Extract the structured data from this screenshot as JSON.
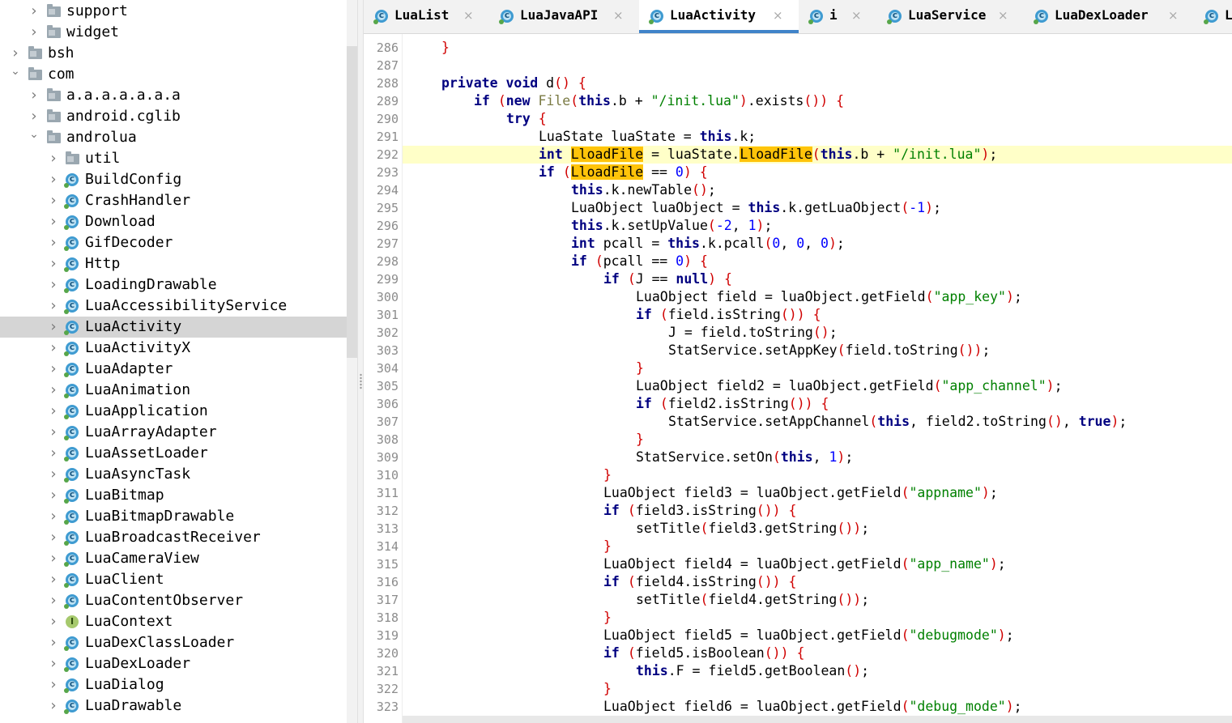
{
  "tree": {
    "items": [
      {
        "label": "support",
        "icon": "folder-icon",
        "depth": 2,
        "expanded": false
      },
      {
        "label": "widget",
        "icon": "folder-icon",
        "depth": 2,
        "expanded": false
      },
      {
        "label": "bsh",
        "icon": "folder-icon",
        "depth": 1,
        "expanded": false
      },
      {
        "label": "com",
        "icon": "folder-icon",
        "depth": 1,
        "expanded": true
      },
      {
        "label": "a.a.a.a.a.a.a",
        "icon": "folder-icon",
        "depth": 2,
        "expanded": false
      },
      {
        "label": "android.cglib",
        "icon": "folder-icon",
        "depth": 2,
        "expanded": false
      },
      {
        "label": "androlua",
        "icon": "folder-icon",
        "depth": 2,
        "expanded": true
      },
      {
        "label": "util",
        "icon": "folder-icon",
        "depth": 3,
        "expanded": false
      },
      {
        "label": "BuildConfig",
        "icon": "class-icon",
        "depth": 3
      },
      {
        "label": "CrashHandler",
        "icon": "class-icon",
        "depth": 3
      },
      {
        "label": "Download",
        "icon": "class-icon",
        "depth": 3
      },
      {
        "label": "GifDecoder",
        "icon": "class-icon",
        "depth": 3
      },
      {
        "label": "Http",
        "icon": "class-icon",
        "depth": 3
      },
      {
        "label": "LoadingDrawable",
        "icon": "class-icon",
        "depth": 3
      },
      {
        "label": "LuaAccessibilityService",
        "icon": "class-icon",
        "depth": 3
      },
      {
        "label": "LuaActivity",
        "icon": "class-icon",
        "depth": 3,
        "selected": true
      },
      {
        "label": "LuaActivityX",
        "icon": "class-icon",
        "depth": 3
      },
      {
        "label": "LuaAdapter",
        "icon": "class-icon",
        "depth": 3
      },
      {
        "label": "LuaAnimation",
        "icon": "class-icon",
        "depth": 3
      },
      {
        "label": "LuaApplication",
        "icon": "class-icon",
        "depth": 3
      },
      {
        "label": "LuaArrayAdapter",
        "icon": "class-icon",
        "depth": 3
      },
      {
        "label": "LuaAssetLoader",
        "icon": "class-icon",
        "depth": 3
      },
      {
        "label": "LuaAsyncTask",
        "icon": "class-icon",
        "depth": 3
      },
      {
        "label": "LuaBitmap",
        "icon": "class-icon",
        "depth": 3
      },
      {
        "label": "LuaBitmapDrawable",
        "icon": "class-icon",
        "depth": 3
      },
      {
        "label": "LuaBroadcastReceiver",
        "icon": "class-icon",
        "depth": 3
      },
      {
        "label": "LuaCameraView",
        "icon": "class-icon",
        "depth": 3
      },
      {
        "label": "LuaClient",
        "icon": "class-icon",
        "depth": 3
      },
      {
        "label": "LuaContentObserver",
        "icon": "class-icon",
        "depth": 3
      },
      {
        "label": "LuaContext",
        "icon": "interface-icon",
        "depth": 3
      },
      {
        "label": "LuaDexClassLoader",
        "icon": "class-icon",
        "depth": 3
      },
      {
        "label": "LuaDexLoader",
        "icon": "class-icon",
        "depth": 3
      },
      {
        "label": "LuaDialog",
        "icon": "class-icon",
        "depth": 3
      },
      {
        "label": "LuaDrawable",
        "icon": "class-icon",
        "depth": 3
      }
    ]
  },
  "tabs": [
    {
      "label": "LuaList",
      "active": false
    },
    {
      "label": "LuaJavaAPI",
      "active": false
    },
    {
      "label": "LuaActivity",
      "active": true
    },
    {
      "label": "i",
      "active": false
    },
    {
      "label": "LuaService",
      "active": false
    },
    {
      "label": "LuaDexLoader",
      "active": false
    },
    {
      "label": "Lu",
      "active": false
    }
  ],
  "editor": {
    "current_line": 292,
    "lines": [
      {
        "n": 286,
        "code": "}"
      },
      {
        "n": 287,
        "code": ""
      },
      {
        "n": 288,
        "code": "private void d() {"
      },
      {
        "n": 289,
        "code": "if (new File(this.b + \"/init.lua\").exists()) {"
      },
      {
        "n": 290,
        "code": "try {"
      },
      {
        "n": 291,
        "code": "LuaState luaState = this.k;"
      },
      {
        "n": 292,
        "code": "int LloadFile = luaState.LloadFile(this.b + \"/init.lua\");"
      },
      {
        "n": 293,
        "code": "if (LloadFile == 0) {"
      },
      {
        "n": 294,
        "code": "this.k.newTable();"
      },
      {
        "n": 295,
        "code": "LuaObject luaObject = this.k.getLuaObject(-1);"
      },
      {
        "n": 296,
        "code": "this.k.setUpValue(-2, 1);"
      },
      {
        "n": 297,
        "code": "int pcall = this.k.pcall(0, 0, 0);"
      },
      {
        "n": 298,
        "code": "if (pcall == 0) {"
      },
      {
        "n": 299,
        "code": "if (J == null) {"
      },
      {
        "n": 300,
        "code": "LuaObject field = luaObject.getField(\"app_key\");"
      },
      {
        "n": 301,
        "code": "if (field.isString()) {"
      },
      {
        "n": 302,
        "code": "J = field.toString();"
      },
      {
        "n": 303,
        "code": "StatService.setAppKey(field.toString());"
      },
      {
        "n": 304,
        "code": "}"
      },
      {
        "n": 305,
        "code": "LuaObject field2 = luaObject.getField(\"app_channel\");"
      },
      {
        "n": 306,
        "code": "if (field2.isString()) {"
      },
      {
        "n": 307,
        "code": "StatService.setAppChannel(this, field2.toString(), true);"
      },
      {
        "n": 308,
        "code": "}"
      },
      {
        "n": 309,
        "code": "StatService.setOn(this, 1);"
      },
      {
        "n": 310,
        "code": "}"
      },
      {
        "n": 311,
        "code": "LuaObject field3 = luaObject.getField(\"appname\");"
      },
      {
        "n": 312,
        "code": "if (field3.isString()) {"
      },
      {
        "n": 313,
        "code": "setTitle(field3.getString());"
      },
      {
        "n": 314,
        "code": "}"
      },
      {
        "n": 315,
        "code": "LuaObject field4 = luaObject.getField(\"app_name\");"
      },
      {
        "n": 316,
        "code": "if (field4.isString()) {"
      },
      {
        "n": 317,
        "code": "setTitle(field4.getString());"
      },
      {
        "n": 318,
        "code": "}"
      },
      {
        "n": 319,
        "code": "LuaObject field5 = luaObject.getField(\"debugmode\");"
      },
      {
        "n": 320,
        "code": "if (field5.isBoolean()) {"
      },
      {
        "n": 321,
        "code": "this.F = field5.getBoolean();"
      },
      {
        "n": 322,
        "code": "}"
      },
      {
        "n": 323,
        "code": "LuaObject field6 = luaObject.getField(\"debug_mode\");"
      }
    ],
    "highlight_word": "LloadFile"
  },
  "colors": {
    "keyword": "#000080",
    "string": "#008000",
    "brace": "#d00000",
    "number": "#0000ff",
    "search_highlight": "#ffc40a",
    "current_line": "#ffffc8",
    "tab_accent": "#4083c9",
    "selection": "#d5d5d5"
  }
}
